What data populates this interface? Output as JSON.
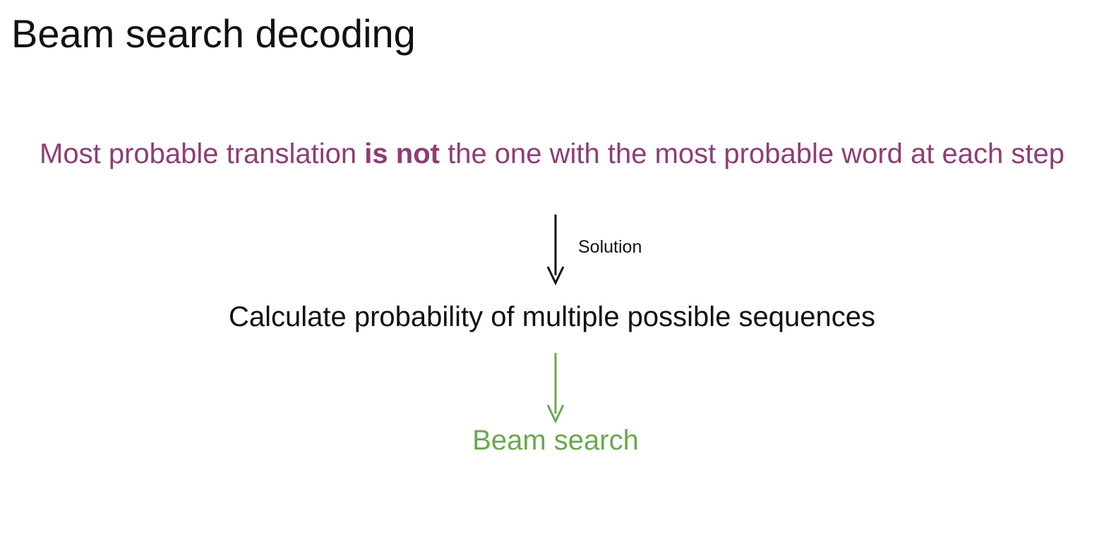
{
  "title": "Beam search decoding",
  "problem": {
    "before": "Most probable translation ",
    "emphasis": "is not",
    "after": " the one with the most probable word at each step"
  },
  "arrow_label": "Solution",
  "step": "Calculate probability of multiple possible sequences",
  "result": "Beam search",
  "colors": {
    "title": "#111111",
    "problem": "#8e3d75",
    "step": "#111111",
    "arrow_solution": "#111111",
    "result": "#6aa84f"
  },
  "icons": [
    "arrow-down-icon",
    "arrow-down-icon"
  ]
}
